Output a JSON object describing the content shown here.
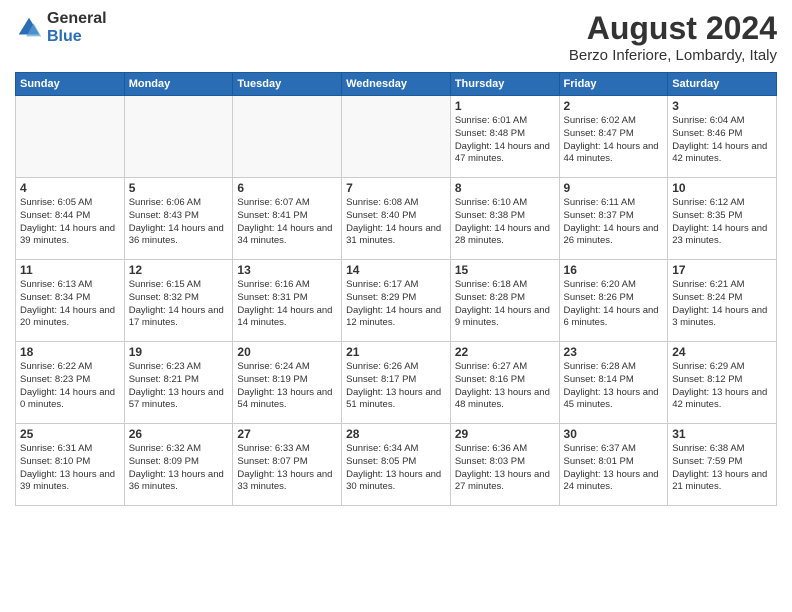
{
  "header": {
    "logo_general": "General",
    "logo_blue": "Blue",
    "month_title": "August 2024",
    "location": "Berzo Inferiore, Lombardy, Italy"
  },
  "weekdays": [
    "Sunday",
    "Monday",
    "Tuesday",
    "Wednesday",
    "Thursday",
    "Friday",
    "Saturday"
  ],
  "weeks": [
    [
      {
        "day": "",
        "sunrise": "",
        "sunset": "",
        "daylight": ""
      },
      {
        "day": "",
        "sunrise": "",
        "sunset": "",
        "daylight": ""
      },
      {
        "day": "",
        "sunrise": "",
        "sunset": "",
        "daylight": ""
      },
      {
        "day": "",
        "sunrise": "",
        "sunset": "",
        "daylight": ""
      },
      {
        "day": "1",
        "sunrise": "6:01 AM",
        "sunset": "8:48 PM",
        "daylight": "14 hours and 47 minutes."
      },
      {
        "day": "2",
        "sunrise": "6:02 AM",
        "sunset": "8:47 PM",
        "daylight": "14 hours and 44 minutes."
      },
      {
        "day": "3",
        "sunrise": "6:04 AM",
        "sunset": "8:46 PM",
        "daylight": "14 hours and 42 minutes."
      }
    ],
    [
      {
        "day": "4",
        "sunrise": "6:05 AM",
        "sunset": "8:44 PM",
        "daylight": "14 hours and 39 minutes."
      },
      {
        "day": "5",
        "sunrise": "6:06 AM",
        "sunset": "8:43 PM",
        "daylight": "14 hours and 36 minutes."
      },
      {
        "day": "6",
        "sunrise": "6:07 AM",
        "sunset": "8:41 PM",
        "daylight": "14 hours and 34 minutes."
      },
      {
        "day": "7",
        "sunrise": "6:08 AM",
        "sunset": "8:40 PM",
        "daylight": "14 hours and 31 minutes."
      },
      {
        "day": "8",
        "sunrise": "6:10 AM",
        "sunset": "8:38 PM",
        "daylight": "14 hours and 28 minutes."
      },
      {
        "day": "9",
        "sunrise": "6:11 AM",
        "sunset": "8:37 PM",
        "daylight": "14 hours and 26 minutes."
      },
      {
        "day": "10",
        "sunrise": "6:12 AM",
        "sunset": "8:35 PM",
        "daylight": "14 hours and 23 minutes."
      }
    ],
    [
      {
        "day": "11",
        "sunrise": "6:13 AM",
        "sunset": "8:34 PM",
        "daylight": "14 hours and 20 minutes."
      },
      {
        "day": "12",
        "sunrise": "6:15 AM",
        "sunset": "8:32 PM",
        "daylight": "14 hours and 17 minutes."
      },
      {
        "day": "13",
        "sunrise": "6:16 AM",
        "sunset": "8:31 PM",
        "daylight": "14 hours and 14 minutes."
      },
      {
        "day": "14",
        "sunrise": "6:17 AM",
        "sunset": "8:29 PM",
        "daylight": "14 hours and 12 minutes."
      },
      {
        "day": "15",
        "sunrise": "6:18 AM",
        "sunset": "8:28 PM",
        "daylight": "14 hours and 9 minutes."
      },
      {
        "day": "16",
        "sunrise": "6:20 AM",
        "sunset": "8:26 PM",
        "daylight": "14 hours and 6 minutes."
      },
      {
        "day": "17",
        "sunrise": "6:21 AM",
        "sunset": "8:24 PM",
        "daylight": "14 hours and 3 minutes."
      }
    ],
    [
      {
        "day": "18",
        "sunrise": "6:22 AM",
        "sunset": "8:23 PM",
        "daylight": "14 hours and 0 minutes."
      },
      {
        "day": "19",
        "sunrise": "6:23 AM",
        "sunset": "8:21 PM",
        "daylight": "13 hours and 57 minutes."
      },
      {
        "day": "20",
        "sunrise": "6:24 AM",
        "sunset": "8:19 PM",
        "daylight": "13 hours and 54 minutes."
      },
      {
        "day": "21",
        "sunrise": "6:26 AM",
        "sunset": "8:17 PM",
        "daylight": "13 hours and 51 minutes."
      },
      {
        "day": "22",
        "sunrise": "6:27 AM",
        "sunset": "8:16 PM",
        "daylight": "13 hours and 48 minutes."
      },
      {
        "day": "23",
        "sunrise": "6:28 AM",
        "sunset": "8:14 PM",
        "daylight": "13 hours and 45 minutes."
      },
      {
        "day": "24",
        "sunrise": "6:29 AM",
        "sunset": "8:12 PM",
        "daylight": "13 hours and 42 minutes."
      }
    ],
    [
      {
        "day": "25",
        "sunrise": "6:31 AM",
        "sunset": "8:10 PM",
        "daylight": "13 hours and 39 minutes."
      },
      {
        "day": "26",
        "sunrise": "6:32 AM",
        "sunset": "8:09 PM",
        "daylight": "13 hours and 36 minutes."
      },
      {
        "day": "27",
        "sunrise": "6:33 AM",
        "sunset": "8:07 PM",
        "daylight": "13 hours and 33 minutes."
      },
      {
        "day": "28",
        "sunrise": "6:34 AM",
        "sunset": "8:05 PM",
        "daylight": "13 hours and 30 minutes."
      },
      {
        "day": "29",
        "sunrise": "6:36 AM",
        "sunset": "8:03 PM",
        "daylight": "13 hours and 27 minutes."
      },
      {
        "day": "30",
        "sunrise": "6:37 AM",
        "sunset": "8:01 PM",
        "daylight": "13 hours and 24 minutes."
      },
      {
        "day": "31",
        "sunrise": "6:38 AM",
        "sunset": "7:59 PM",
        "daylight": "13 hours and 21 minutes."
      }
    ]
  ]
}
